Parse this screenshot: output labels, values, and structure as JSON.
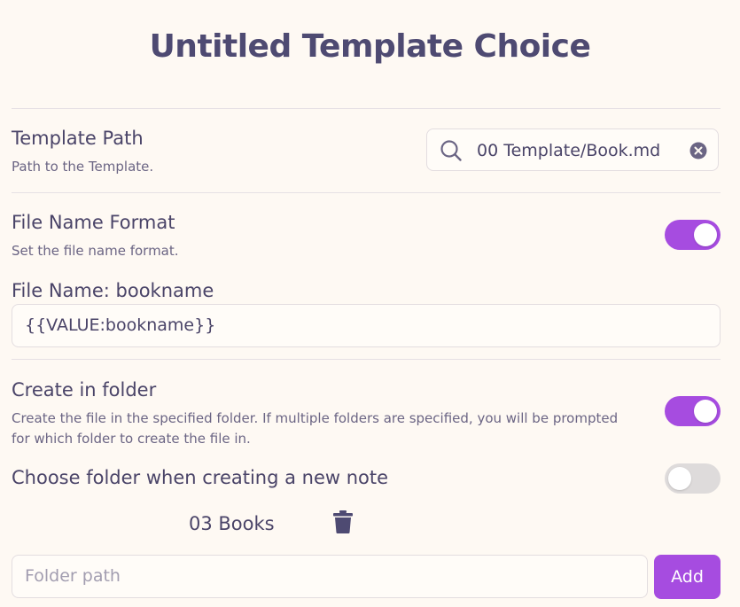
{
  "modal": {
    "title": "Untitled Template Choice"
  },
  "template_path": {
    "name": "Template Path",
    "desc": "Path to the Template.",
    "value": "00 Template/Book.md",
    "search_icon": "search-icon",
    "clear_icon": "clear-icon"
  },
  "file_name_format": {
    "name": "File Name Format",
    "desc": "Set the file name format.",
    "enabled": true,
    "preview_label": "File Name: bookname",
    "value": "{{VALUE:bookname}}"
  },
  "create_in_folder": {
    "name": "Create in folder",
    "desc_line1": "Create the file in the specified folder. If multiple folders are specified, you will be prompted",
    "desc_line2": "for which folder to create the file in.",
    "enabled": true
  },
  "choose_folder": {
    "name": "Choose folder when creating a new note",
    "enabled": false
  },
  "folders": {
    "items": [
      "03 Books"
    ],
    "delete_icon": "trash-icon",
    "placeholder": "Folder path",
    "add_label": "Add"
  },
  "colors": {
    "accent": "#a64ce0",
    "background": "#fef9f3",
    "text": "#4a4468",
    "toggle_off": "#dedbdb"
  }
}
